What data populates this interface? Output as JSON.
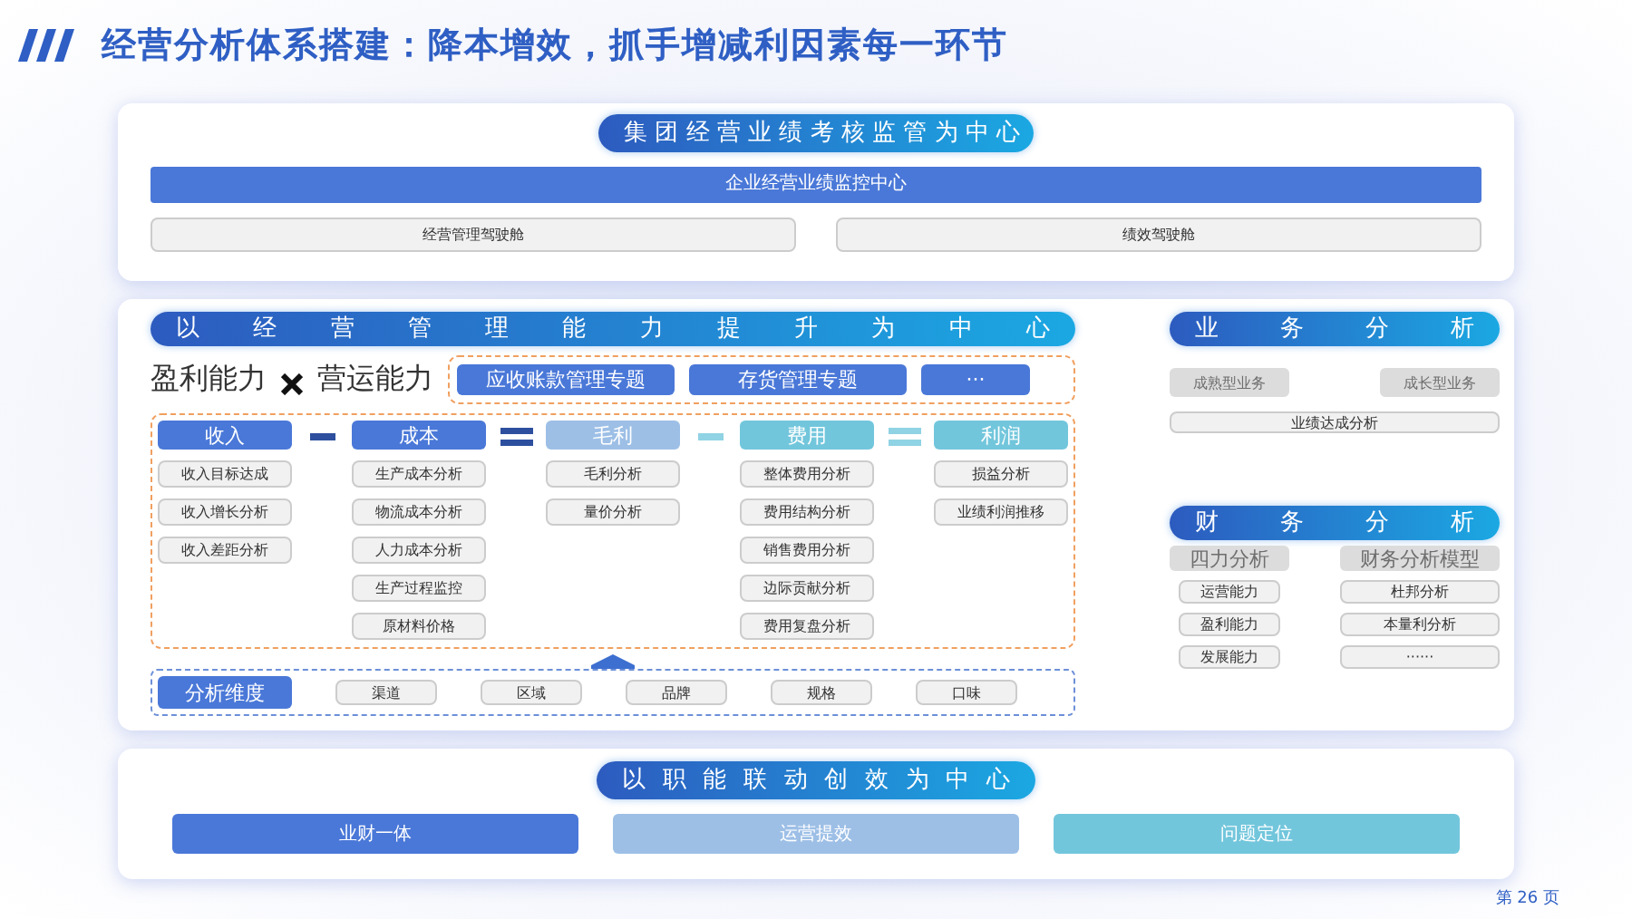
{
  "title": "经营分析体系搭建：降本增效，抓手增减利因素每一环节",
  "panel_top": {
    "heading": "集 团 经 营 业 绩 考 核 监 管 为 中 心",
    "bar": "企业经营业绩监控中心",
    "buttons": [
      "经营管理驾驶舱",
      "绩效驾驶舱"
    ]
  },
  "panel_mid": {
    "heading": "以 经 营 管 理 能 力 提 升 为 中 心",
    "abilities": [
      "盈利能力",
      "营运能力"
    ],
    "topics": [
      "应收账款管理专题",
      "存货管理专题",
      "···"
    ],
    "formula": [
      {
        "label": "收入",
        "color": "#4a78d8",
        "items": [
          "收入目标达成",
          "收入增长分析",
          "收入差距分析"
        ],
        "operator": {
          "kind": "minus",
          "color": "#2d4f9e"
        }
      },
      {
        "label": "成本",
        "color": "#4a78d8",
        "items": [
          "生产成本分析",
          "物流成本分析",
          "人力成本分析",
          "生产过程监控",
          "原材料价格"
        ],
        "operator": {
          "kind": "equals",
          "color": "#2d4f9e"
        }
      },
      {
        "label": "毛利",
        "color": "#9dbfe6",
        "items": [
          "毛利分析",
          "量价分析"
        ],
        "operator": {
          "kind": "minus",
          "color": "#8fd3e4"
        }
      },
      {
        "label": "费用",
        "color": "#72c6dc",
        "items": [
          "整体费用分析",
          "费用结构分析",
          "销售费用分析",
          "边际贡献分析",
          "费用复盘分析"
        ],
        "operator": {
          "kind": "equals",
          "color": "#8fd3e4"
        }
      },
      {
        "label": "利润",
        "color": "#72c6dc",
        "items": [
          "损益分析",
          "业绩利润推移"
        ]
      }
    ],
    "dimensions": {
      "label": "分析维度",
      "items": [
        "渠道",
        "区域",
        "品牌",
        "规格",
        "口味"
      ]
    }
  },
  "business": {
    "heading": "业 务 分 析",
    "types": [
      "成熟型业务",
      "成长型业务"
    ],
    "item": "业绩达成分析"
  },
  "finance": {
    "heading": "财 务 分 析",
    "groups": [
      {
        "label": "四力分析",
        "items": [
          "运营能力",
          "盈利能力",
          "发展能力"
        ]
      },
      {
        "label": "财务分析模型",
        "items": [
          "杜邦分析",
          "本量利分析",
          "······"
        ]
      }
    ]
  },
  "panel_bottom": {
    "heading": "以 职 能 联 动 创 效 为 中 心",
    "items": [
      {
        "label": "业财一体",
        "color": "#4a78d8"
      },
      {
        "label": "运营提效",
        "color": "#9dbfe6"
      },
      {
        "label": "问题定位",
        "color": "#72c6dc"
      }
    ]
  },
  "page": "第 26 页"
}
